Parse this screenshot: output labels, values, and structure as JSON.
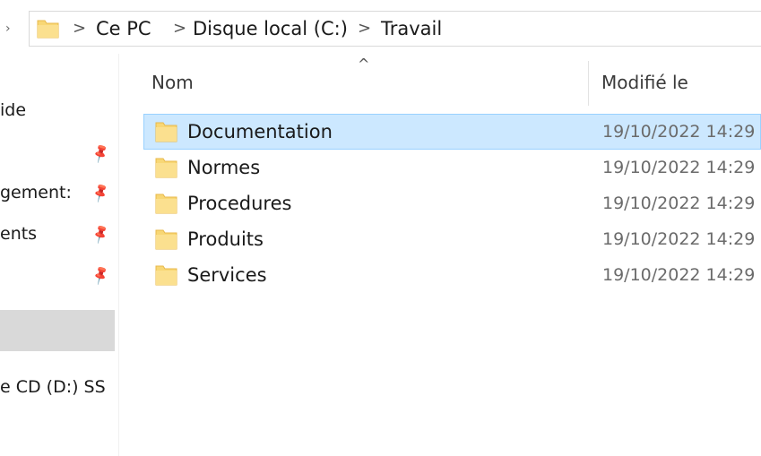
{
  "address_bar": {
    "crumbs": [
      "Ce PC",
      "Disque local (C:)",
      "Travail"
    ],
    "separator": ">"
  },
  "nav_pane": {
    "items": [
      {
        "label": "ide",
        "pinned": false
      },
      {
        "label": "",
        "pinned": true
      },
      {
        "label": "gement:",
        "pinned": true
      },
      {
        "label": "ents",
        "pinned": true
      },
      {
        "label": "",
        "pinned": true
      },
      {
        "label": "",
        "pinned": false
      },
      {
        "label": "e CD (D:) SS",
        "pinned": false
      }
    ],
    "pin_icon": "pin-icon"
  },
  "columns": {
    "name": "Nom",
    "modified": "Modifié le"
  },
  "files": [
    {
      "name": "Documentation",
      "modified": "19/10/2022 14:29",
      "selected": true
    },
    {
      "name": "Normes",
      "modified": "19/10/2022 14:29",
      "selected": false
    },
    {
      "name": "Procedures",
      "modified": "19/10/2022 14:29",
      "selected": false
    },
    {
      "name": "Produits",
      "modified": "19/10/2022 14:29",
      "selected": false
    },
    {
      "name": "Services",
      "modified": "19/10/2022 14:29",
      "selected": false
    }
  ],
  "colors": {
    "selection_bg": "#cce8ff",
    "selection_border": "#99d1ff",
    "folder_yellow": "#f8d775",
    "folder_dark": "#e8b84a"
  }
}
